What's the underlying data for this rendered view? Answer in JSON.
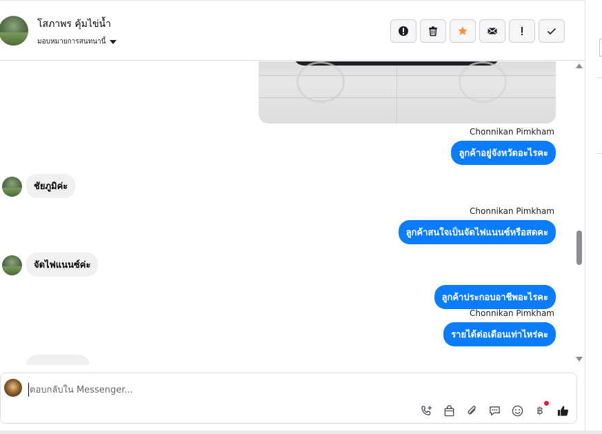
{
  "header": {
    "contact_name": "โสภาพร คุ้มไข่น้ำ",
    "assign_label": "มอบหมายการสนทนานี้",
    "actions": [
      {
        "name": "report-spam",
        "icon": "exclamation-circle-icon",
        "color": "#1c1e21"
      },
      {
        "name": "delete",
        "icon": "trash-icon",
        "color": "#1c1e21"
      },
      {
        "name": "star",
        "icon": "star-icon",
        "color": "#f7923a"
      },
      {
        "name": "mark-unread",
        "icon": "envelope-icon",
        "color": "#1c1e21"
      },
      {
        "name": "follow-up",
        "icon": "exclamation-icon",
        "color": "#1c1e21"
      },
      {
        "name": "mark-done",
        "icon": "checkmark-icon",
        "color": "#1c1e21"
      }
    ]
  },
  "messages": [
    {
      "type": "out",
      "sender": "Chonnikan Pimkham",
      "text": "ลูกค้าอยู่จังหวัดอะไรคะ"
    },
    {
      "type": "in",
      "text": "ชัยภูมิค่ะ"
    },
    {
      "type": "out",
      "sender": "Chonnikan Pimkham",
      "text": "ลูกค้าสนใจเป็นจัดไฟแนนซ์หรือสดคะ"
    },
    {
      "type": "in",
      "text": "จัดไฟแนนซ์ค่ะ"
    },
    {
      "type": "out",
      "text": "ลูกค้าประกอบอาชีพอะไรคะ"
    },
    {
      "type": "out",
      "sender": "Chonnikan Pimkham",
      "text": "รายได้ต่อเดือนเท่าไหร่คะ"
    }
  ],
  "composer": {
    "placeholder": "ตอบกลับใน Messenger...",
    "tools": [
      "phone-plus-icon",
      "shopping-bag-icon",
      "paperclip-icon",
      "chat-bubble-icon",
      "emoji-icon",
      "baht-icon",
      "thumbs-up-icon"
    ],
    "baht_symbol": "฿"
  },
  "colors": {
    "outgoing_bubble": "#0a7cff",
    "incoming_bubble": "#f0f0f0",
    "star": "#f7923a",
    "notification_dot": "#e41e3f"
  }
}
